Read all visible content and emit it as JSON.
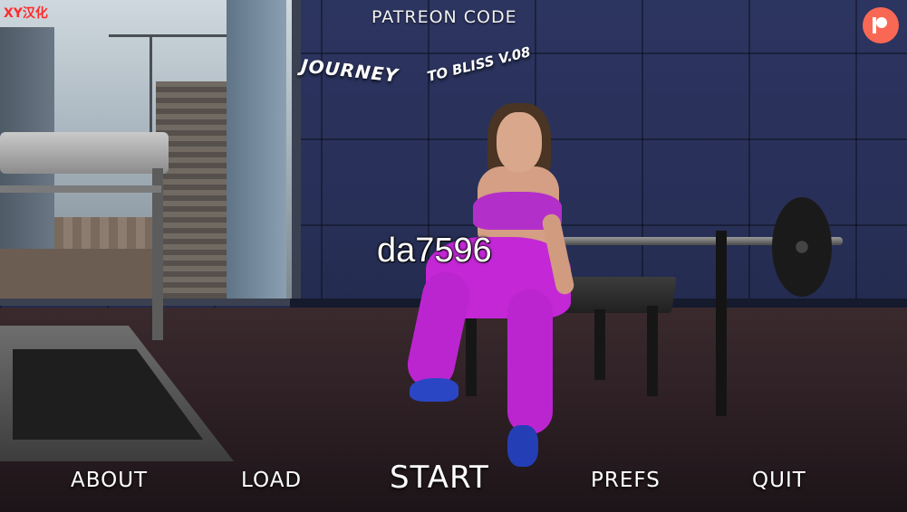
{
  "watermark": "XY汉化",
  "header": {
    "patreon_code_label": "PATREON CODE"
  },
  "logo": {
    "line1": "JOURNEY",
    "line2": "TO BLISS V.08"
  },
  "overlay_user_id": "da7596",
  "patreon_button": {
    "icon": "patreon-icon",
    "color": "#f96854"
  },
  "main_menu": {
    "about": "ABOUT",
    "load": "LOAD",
    "start": "START",
    "prefs": "PREFS",
    "quit": "QUIT"
  },
  "colors": {
    "menu_text": "#ffffff",
    "watermark": "#ff2b2b",
    "outfit": "#c327d6"
  }
}
